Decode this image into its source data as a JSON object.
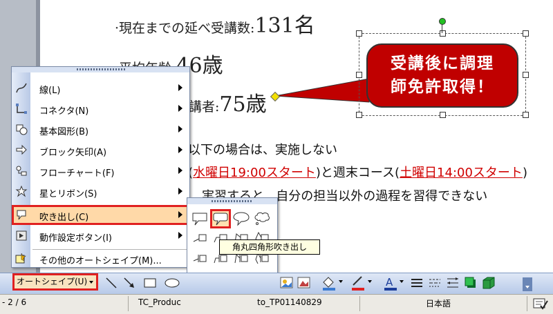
{
  "document": {
    "line1_label": "·現在までの延べ受講数:",
    "line1_value": "131名",
    "line2_label": "·平均年齢:",
    "line2_value": "46歳",
    "line3_partial": "講者:",
    "line3_value": "75歳",
    "line4_partial": "以下の場合は、実施しない",
    "line5_partial": "(",
    "line5_red1": "水曜日19:00スタート",
    "line5_mid": ")と週末コース(",
    "line5_red2": "土曜日14:00スタート",
    "line5_end": ")",
    "line6_partial": "実習すると、自分の担当以外の過程を習得できない"
  },
  "callout": {
    "line1": "受講後に調理",
    "line2": "師免許取得！",
    "fill_color": "#c00000"
  },
  "autoshape_menu": {
    "items": [
      {
        "label": "線(L)",
        "icon": "line-icon"
      },
      {
        "label": "コネクタ(N)",
        "icon": "connector-icon"
      },
      {
        "label": "基本図形(B)",
        "icon": "basic-shapes-icon"
      },
      {
        "label": "ブロック矢印(A)",
        "icon": "block-arrows-icon"
      },
      {
        "label": "フローチャート(F)",
        "icon": "flowchart-icon"
      },
      {
        "label": "星とリボン(S)",
        "icon": "stars-ribbons-icon"
      },
      {
        "label": "吹き出し(C)",
        "icon": "callouts-icon"
      },
      {
        "label": "動作設定ボタン(I)",
        "icon": "action-buttons-icon"
      },
      {
        "label": "その他のオートシェイプ(M)...",
        "icon": "more-autoshapes-icon"
      }
    ],
    "highlighted_index": 6
  },
  "callout_submenu": {
    "tooltip": "角丸四角形吹き出し"
  },
  "toolbar": {
    "autoshape_label": "オートシェイプ(U)"
  },
  "statusbar": {
    "page": "- 2 / 6",
    "template": "TC_Produc",
    "template_id": "to_TP01140829",
    "language": "日本語"
  },
  "colors": {
    "highlight_border": "#e02020",
    "menu_highlight": "#ffd9a8",
    "callout_red": "#c00000"
  }
}
